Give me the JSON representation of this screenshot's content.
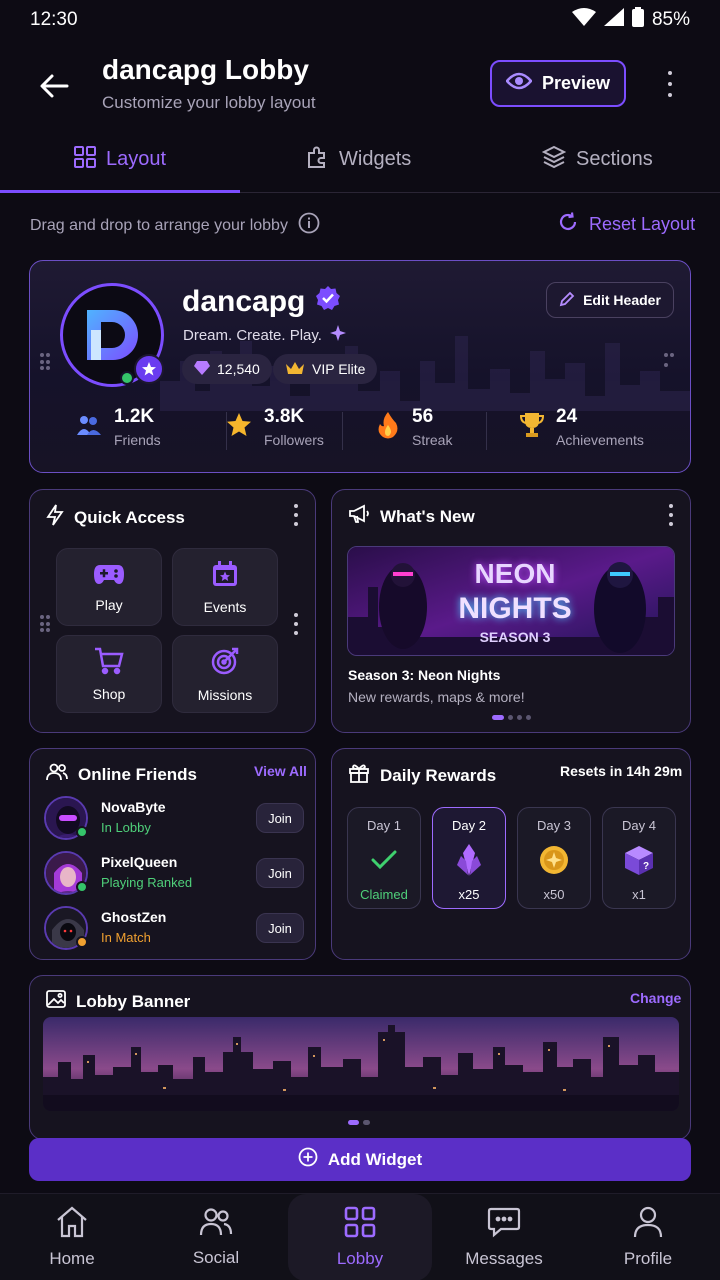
{
  "status": {
    "time": "12:30",
    "battery": "85%"
  },
  "header": {
    "title": "dancapg Lobby",
    "subtitle": "Customize your lobby layout",
    "preview_label": "Preview"
  },
  "tabs": [
    {
      "label": "Layout",
      "icon": "grid-icon",
      "active": true
    },
    {
      "label": "Widgets",
      "icon": "puzzle-icon",
      "active": false
    },
    {
      "label": "Sections",
      "icon": "layers-icon",
      "active": false
    }
  ],
  "hint": "Drag and drop to arrange your lobby",
  "reset_label": "Reset Layout",
  "profile": {
    "username": "dancapg",
    "tagline": "Dream. Create. Play.",
    "gems": "12,540",
    "vip": "VIP Elite",
    "edit_label": "Edit Header",
    "stats": [
      {
        "value": "1.2K",
        "label": "Friends",
        "icon": "friends-icon"
      },
      {
        "value": "3.8K",
        "label": "Followers",
        "icon": "star-icon"
      },
      {
        "value": "56",
        "label": "Streak",
        "icon": "flame-icon"
      },
      {
        "value": "24",
        "label": "Achievements",
        "icon": "trophy-icon"
      }
    ]
  },
  "quick_access": {
    "title": "Quick Access",
    "tiles": [
      {
        "label": "Play",
        "icon": "gamepad-icon"
      },
      {
        "label": "Events",
        "icon": "calendar-icon"
      },
      {
        "label": "Shop",
        "icon": "cart-icon"
      },
      {
        "label": "Missions",
        "icon": "target-icon"
      }
    ]
  },
  "whats_new": {
    "title": "What's New",
    "banner_line1": "NEON",
    "banner_line2": "NIGHTS",
    "banner_line3": "SEASON 3",
    "headline": "Season 3: Neon Nights",
    "desc": "New rewards, maps & more!"
  },
  "friends": {
    "title": "Online Friends",
    "view_all": "View All",
    "join_label": "Join",
    "items": [
      {
        "name": "NovaByte",
        "status": "In Lobby",
        "status_color": "#4fd07a"
      },
      {
        "name": "PixelQueen",
        "status": "Playing Ranked",
        "status_color": "#4fd07a"
      },
      {
        "name": "GhostZen",
        "status": "In Match",
        "status_color": "#f0a030"
      }
    ]
  },
  "daily": {
    "title": "Daily Rewards",
    "resets": "Resets in 14h 29m",
    "days": [
      {
        "label": "Day 1",
        "amount": "Claimed",
        "icon": "check-icon"
      },
      {
        "label": "Day 2",
        "amount": "x25",
        "icon": "crystal-icon"
      },
      {
        "label": "Day 3",
        "amount": "x50",
        "icon": "coin-icon"
      },
      {
        "label": "Day 4",
        "amount": "x1",
        "icon": "mystery-box-icon"
      }
    ]
  },
  "banner": {
    "title": "Lobby Banner",
    "change_label": "Change"
  },
  "add_widget": "Add Widget",
  "nav": [
    {
      "label": "Home",
      "icon": "home-icon"
    },
    {
      "label": "Social",
      "icon": "people-icon"
    },
    {
      "label": "Lobby",
      "icon": "grid-icon"
    },
    {
      "label": "Messages",
      "icon": "chat-icon"
    },
    {
      "label": "Profile",
      "icon": "person-icon"
    }
  ],
  "colors": {
    "accent": "#7c4dff",
    "accent_text": "#9d6bff",
    "background": "#0d0b14"
  }
}
